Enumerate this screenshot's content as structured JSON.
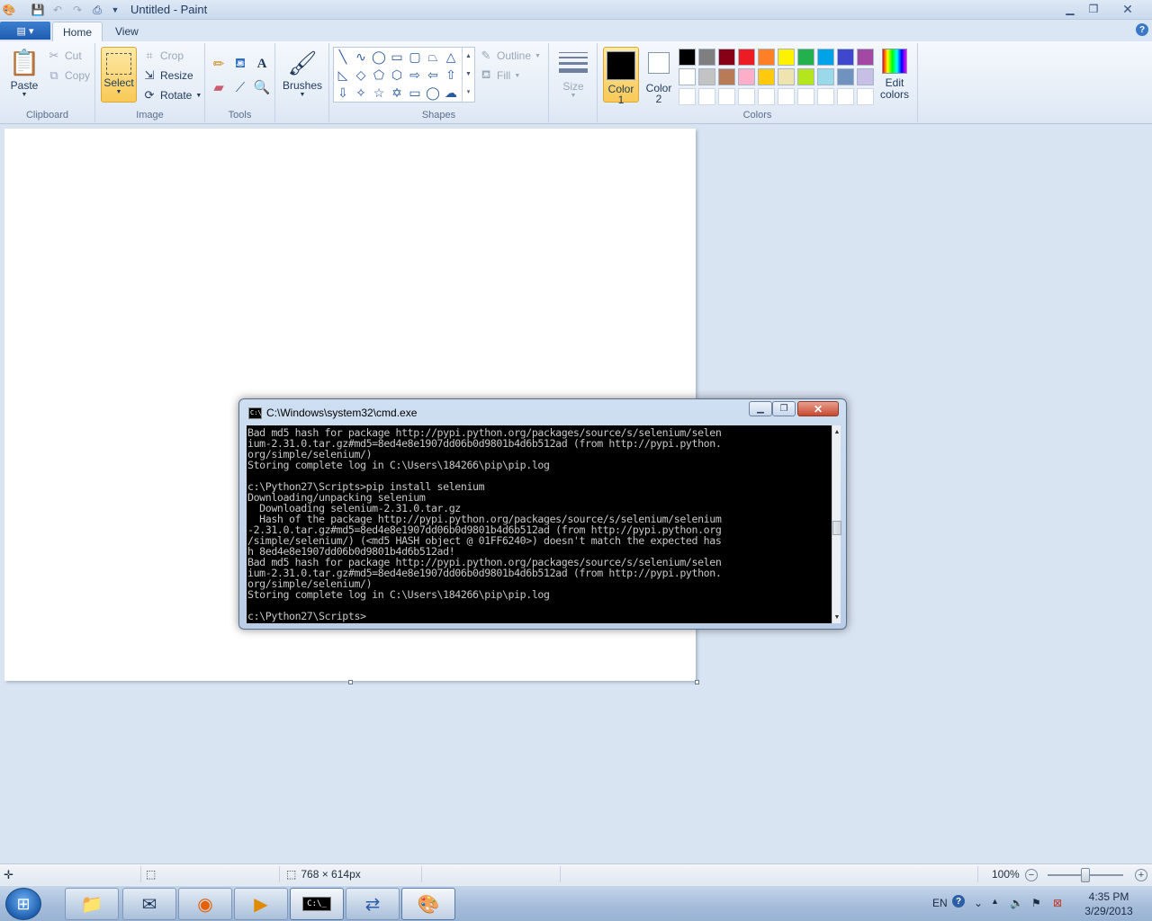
{
  "window": {
    "title": "Untitled - Paint"
  },
  "tabs": {
    "home": "Home",
    "view": "View"
  },
  "ribbon": {
    "clipboard": {
      "label": "Clipboard",
      "paste": "Paste",
      "cut": "Cut",
      "copy": "Copy"
    },
    "image": {
      "label": "Image",
      "select": "Select",
      "crop": "Crop",
      "resize": "Resize",
      "rotate": "Rotate"
    },
    "tools": {
      "label": "Tools"
    },
    "brushes": {
      "label": "Brushes"
    },
    "shapes": {
      "label": "Shapes",
      "outline": "Outline",
      "fill": "Fill"
    },
    "size": {
      "label": "Size"
    },
    "colors": {
      "label": "Colors",
      "color1_line1": "Color",
      "color1_line2": "1",
      "color2_line1": "Color",
      "color2_line2": "2",
      "edit_line1": "Edit",
      "edit_line2": "colors",
      "color1_value": "#000000",
      "color2_value": "#ffffff",
      "palette_row1": [
        "#000000",
        "#7f7f7f",
        "#880015",
        "#ed1c24",
        "#ff7f27",
        "#fff200",
        "#22b14c",
        "#00a2e8",
        "#3f48cc",
        "#a349a4"
      ],
      "palette_row2": [
        "#ffffff",
        "#c3c3c3",
        "#b97a57",
        "#ffaec9",
        "#ffc90e",
        "#efe4b0",
        "#b5e61d",
        "#99d9ea",
        "#7092be",
        "#c8bfe7"
      ],
      "palette_row3": [
        "#ffffff",
        "#ffffff",
        "#ffffff",
        "#ffffff",
        "#ffffff",
        "#ffffff",
        "#ffffff",
        "#ffffff",
        "#ffffff",
        "#ffffff"
      ]
    }
  },
  "cmd": {
    "title": "C:\\Windows\\system32\\cmd.exe",
    "icon_text": "C:\\_",
    "output": "Bad md5 hash for package http://pypi.python.org/packages/source/s/selenium/selen\nium-2.31.0.tar.gz#md5=8ed4e8e1907dd06b0d9801b4d6b512ad (from http://pypi.python.\norg/simple/selenium/)\nStoring complete log in C:\\Users\\184266\\pip\\pip.log\n\nc:\\Python27\\Scripts>pip install selenium\nDownloading/unpacking selenium\n  Downloading selenium-2.31.0.tar.gz\n  Hash of the package http://pypi.python.org/packages/source/s/selenium/selenium\n-2.31.0.tar.gz#md5=8ed4e8e1907dd06b0d9801b4d6b512ad (from http://pypi.python.org\n/simple/selenium/) (<md5 HASH object @ 01FF6240>) doesn't match the expected has\nh 8ed4e8e1907dd06b0d9801b4d6b512ad!\nBad md5 hash for package http://pypi.python.org/packages/source/s/selenium/selen\nium-2.31.0.tar.gz#md5=8ed4e8e1907dd06b0d9801b4d6b512ad (from http://pypi.python.\norg/simple/selenium/)\nStoring complete log in C:\\Users\\184266\\pip\\pip.log\n\nc:\\Python27\\Scripts>"
  },
  "statusbar": {
    "image_size": "768 × 614px",
    "zoom": "100%"
  },
  "taskbar": {
    "language": "EN",
    "time": "4:35 PM",
    "date": "3/29/2013"
  }
}
